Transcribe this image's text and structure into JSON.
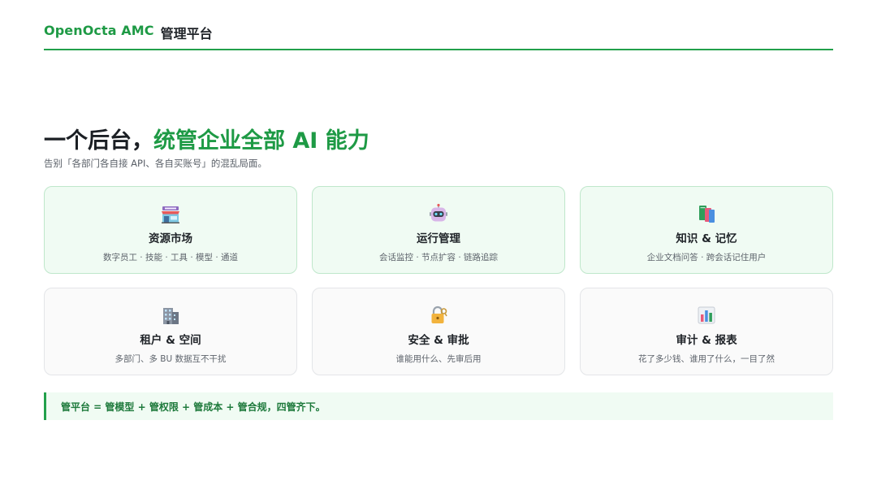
{
  "header": {
    "brand": "OpenOcta AMC",
    "suffix": "管理平台"
  },
  "hero": {
    "title_prefix": "一个后台，",
    "title_accent": "统管企业全部 AI 能力",
    "subtitle": "告别「各部门各自接 API、各自买账号」的混乱局面。"
  },
  "cards": [
    {
      "icon": "storefront-icon",
      "title": "资源市场",
      "desc": "数字员工 · 技能 · 工具 · 模型 · 通道",
      "highlighted": true
    },
    {
      "icon": "robot-icon",
      "title": "运行管理",
      "desc": "会话监控 · 节点扩容 · 链路追踪",
      "highlighted": true
    },
    {
      "icon": "books-icon",
      "title": "知识 & 记忆",
      "desc": "企业文档问答 · 跨会话记住用户",
      "highlighted": true
    },
    {
      "icon": "office-building-icon",
      "title": "租户 & 空间",
      "desc": "多部门、多 BU 数据互不干扰",
      "highlighted": false
    },
    {
      "icon": "lock-key-icon",
      "title": "安全 & 审批",
      "desc": "谁能用什么、先审后用",
      "highlighted": false
    },
    {
      "icon": "bar-chart-icon",
      "title": "审计 & 报表",
      "desc": "花了多少钱、谁用了什么，一目了然",
      "highlighted": false
    }
  ],
  "footer": {
    "note": "管平台 = 管模型 + 管权限 + 管成本 + 管合规，四管齐下。"
  }
}
